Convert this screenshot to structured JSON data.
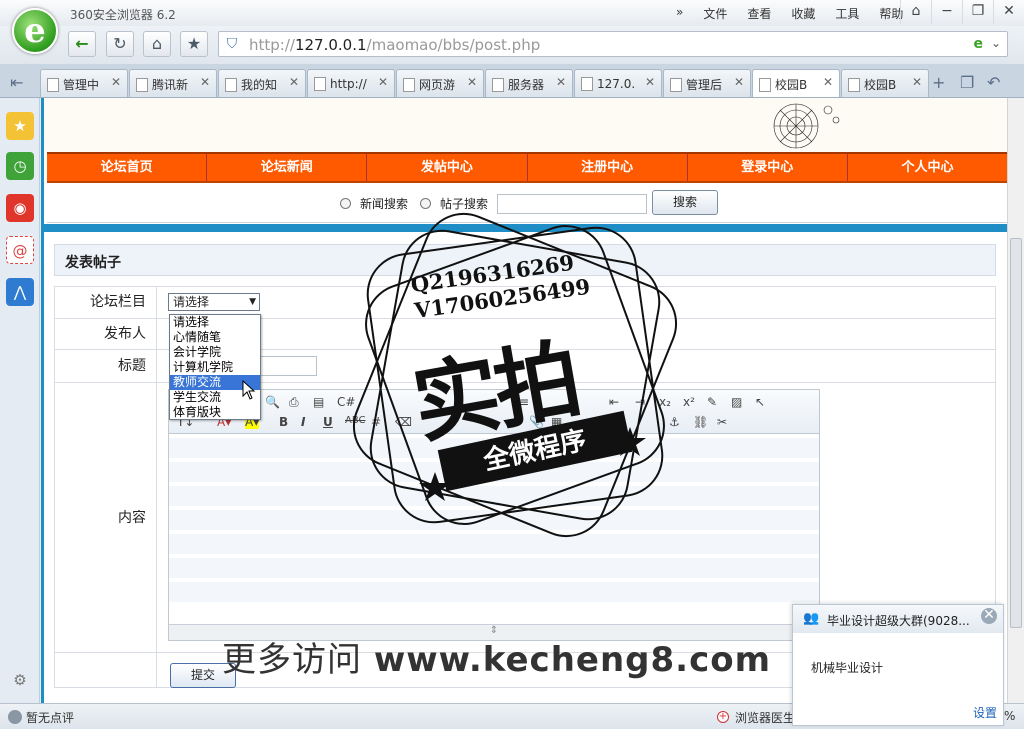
{
  "browser": {
    "title": "360安全浏览器 6.2",
    "logo_letter": "e",
    "menu": [
      "文件",
      "查看",
      "收藏",
      "工具",
      "帮助"
    ],
    "url_host": "127.0.0.1",
    "url_path": "/maomao/bbs/post.php",
    "url_scheme": "http://",
    "tabs": [
      "管理中",
      "腾讯新",
      "我的知",
      "http://",
      "网页游",
      "服务器",
      "127.0.",
      "管理后",
      "校园B",
      "校园B"
    ],
    "active_tab_index": 8
  },
  "site": {
    "nav": [
      "论坛首页",
      "论坛新闻",
      "发帖中心",
      "注册中心",
      "登录中心",
      "个人中心"
    ],
    "search": {
      "radio1": "新闻搜索",
      "radio2": "帖子搜索",
      "button": "搜索"
    }
  },
  "form": {
    "panel_title": "发表帖子",
    "labels": {
      "category": "论坛栏目",
      "author": "发布人",
      "title": "标题",
      "content": "内容"
    },
    "category_selected": "请选择",
    "category_options": [
      "请选择",
      "心情随笔",
      "会计学院",
      "计算机学院",
      "教师交流",
      "学生交流",
      "体育版块"
    ],
    "highlighted_option_index": 4,
    "submit_label": "提交"
  },
  "watermark": {
    "qq": "Q2196316269",
    "vx": "V17060256499",
    "big": "实拍",
    "ribbon": "全微程序",
    "bottom_prefix": "更多访问 ",
    "bottom_url": "www.kecheng8.com"
  },
  "popup": {
    "title": "毕业设计超级大群(9028...",
    "message": "机械毕业设计",
    "settings": "设置"
  },
  "status": {
    "left": "暂无点评",
    "doctor": "浏览器医生",
    "zoom_suffix": "%"
  }
}
